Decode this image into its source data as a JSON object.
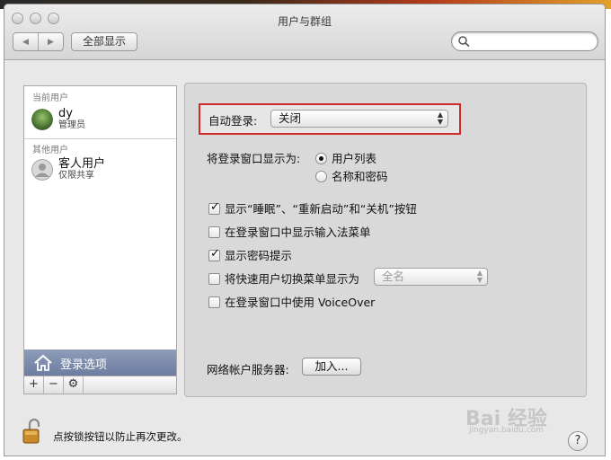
{
  "window": {
    "title": "用户与群组"
  },
  "toolbar": {
    "show_all_label": "全部显示",
    "search_placeholder": ""
  },
  "sidebar": {
    "current_users_label": "当前用户",
    "current_user": {
      "name": "dy",
      "role": "管理员"
    },
    "other_users_label": "其他用户",
    "guest_user": {
      "name": "客人用户",
      "role": "仅限共享"
    },
    "login_options_label": "登录选项",
    "add_symbol": "+",
    "remove_symbol": "−"
  },
  "login": {
    "auto_login_label": "自动登录:",
    "auto_login_value": "关闭",
    "display_as_label": "将登录窗口显示为:",
    "display_options": [
      {
        "label": "用户列表",
        "selected": true
      },
      {
        "label": "名称和密码",
        "selected": false
      }
    ],
    "checkboxes": [
      {
        "label": "显示“睡眠”、“重新启动”和“关机”按钮",
        "checked": true
      },
      {
        "label": "在登录窗口中显示输入法菜单",
        "checked": false
      },
      {
        "label": "显示密码提示",
        "checked": true
      },
      {
        "label": "将快速用户切换菜单显示为",
        "checked": false
      },
      {
        "label": "在登录窗口中使用 VoiceOver",
        "checked": false
      }
    ],
    "fast_switch_value": "全名",
    "network_server_label": "网络帐户服务器:",
    "join_button": "加入..."
  },
  "footer": {
    "lock_text": "点按锁按钮以防止再次更改。",
    "help_symbol": "?"
  },
  "watermark": {
    "main": "Bai 经验",
    "sub": "jingyan.baidu.com"
  },
  "colors": {
    "highlight_box": "#d12a2a",
    "selected_sidebar": "#7b8aac"
  }
}
